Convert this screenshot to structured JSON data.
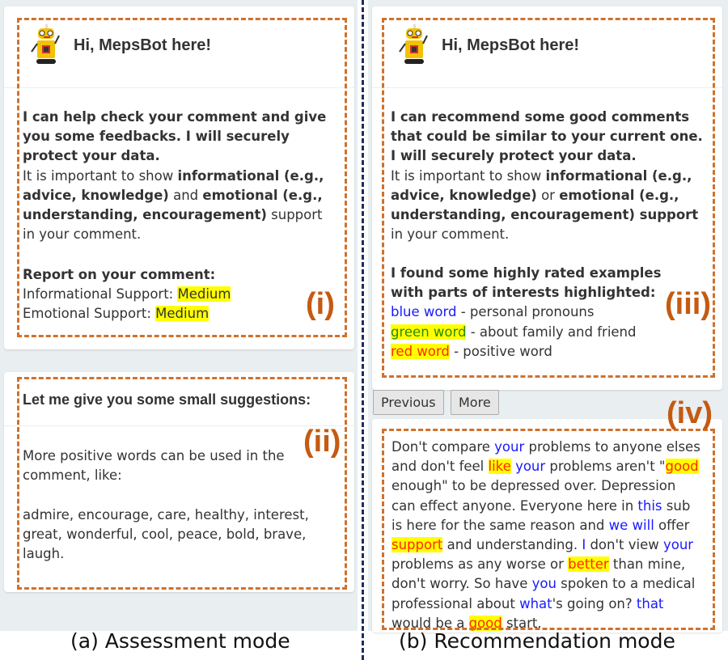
{
  "assessment": {
    "header": "Hi, MepsBot here!",
    "intro_bold": "I can help check your comment and give you some feedbacks. I will securely protect your data.",
    "intro_p1": "It is important to show ",
    "intro_b1": "informational (e.g., advice, knowledge)",
    "intro_p2": " and ",
    "intro_b2": "emotional (e.g., understanding, encouragement)",
    "intro_p3": " support in your comment.",
    "report_title": "Report on your comment:",
    "info_label": "Informational Support: ",
    "info_value": "Medium",
    "emo_label": "Emotional Support: ",
    "emo_value": "Medium",
    "tag": "(i)"
  },
  "suggestions": {
    "header": "Let me give you some small suggestions:",
    "line1": "More positive words can be used in the comment, like:",
    "words": "admire, encourage, care, healthy, interest, great, wonderful, cool, peace, bold, brave, laugh.",
    "tag": "(ii)"
  },
  "recommendation": {
    "header": "Hi, MepsBot here!",
    "intro_bold": "I can recommend some good comments that could be similar to your current one. I will securely protect your data.",
    "intro_p1": "It is important to show ",
    "intro_b1": "informational (e.g., advice, knowledge)",
    "intro_p2": " or ",
    "intro_b2": "emotional (e.g., understanding, encouragement) support",
    "intro_p3": " in your comment.",
    "examples_title": "I found some highly rated examples with parts of interests highlighted:",
    "legend": [
      {
        "word": "blue word",
        "desc": " - personal pronouns",
        "type": "pro"
      },
      {
        "word": "green word",
        "desc": " - about family and friend",
        "type": "fam"
      },
      {
        "word": "red word",
        "desc": " - positive word",
        "type": "pos"
      }
    ],
    "tag": "(iii)",
    "previous_label": "Previous",
    "more_label": "More"
  },
  "example": {
    "tag": "(iv)",
    "segments": [
      {
        "t": "Don't compare ",
        "c": ""
      },
      {
        "t": "your",
        "c": "pro"
      },
      {
        "t": " problems to anyone elses and don't feel ",
        "c": ""
      },
      {
        "t": "like",
        "c": "pos"
      },
      {
        "t": " ",
        "c": ""
      },
      {
        "t": "your",
        "c": "pro"
      },
      {
        "t": " problems aren't \"",
        "c": ""
      },
      {
        "t": "good",
        "c": "pos"
      },
      {
        "t": " enough\" to be depressed over. Depression can effect anyone. Everyone here in ",
        "c": ""
      },
      {
        "t": "this",
        "c": "pro"
      },
      {
        "t": " sub is here for the same reason and ",
        "c": ""
      },
      {
        "t": "we will",
        "c": "pro"
      },
      {
        "t": " offer ",
        "c": ""
      },
      {
        "t": "support",
        "c": "pos"
      },
      {
        "t": " and understanding. ",
        "c": ""
      },
      {
        "t": "I",
        "c": "pro"
      },
      {
        "t": " don't view ",
        "c": ""
      },
      {
        "t": "your",
        "c": "pro"
      },
      {
        "t": " problems as any worse or ",
        "c": ""
      },
      {
        "t": "better",
        "c": "pos"
      },
      {
        "t": " than mine, don't worry. So have ",
        "c": ""
      },
      {
        "t": "you",
        "c": "pro"
      },
      {
        "t": " spoken to a medical professional about ",
        "c": ""
      },
      {
        "t": "what",
        "c": "pro"
      },
      {
        "t": "'s going on? ",
        "c": ""
      },
      {
        "t": "that",
        "c": "pro"
      },
      {
        "t": " would be a ",
        "c": ""
      },
      {
        "t": "good",
        "c": "pos"
      },
      {
        "t": " start.",
        "c": ""
      }
    ]
  },
  "captions": {
    "a": "(a) Assessment mode",
    "b": "(b) Recommendation mode"
  },
  "colors": {
    "accent": "#c55a11",
    "pronoun": "#1a1aff",
    "positive": "#ff2a00",
    "family": "#2a8a00",
    "highlight": "#ffff00"
  }
}
